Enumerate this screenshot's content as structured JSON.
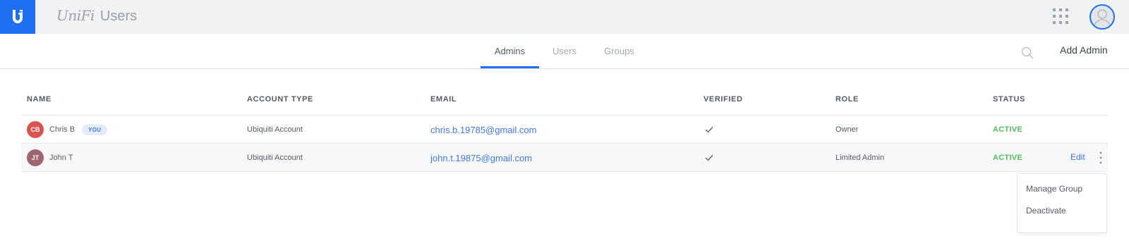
{
  "app": {
    "brand": "UniFi",
    "title": "Users"
  },
  "tabs": [
    {
      "label": "Admins",
      "active": true
    },
    {
      "label": "Users",
      "active": false
    },
    {
      "label": "Groups",
      "active": false
    }
  ],
  "actions": {
    "add_admin": "Add Admin"
  },
  "table": {
    "columns": [
      "NAME",
      "ACCOUNT TYPE",
      "EMAIL",
      "VERIFIED",
      "ROLE",
      "STATUS"
    ],
    "rows": [
      {
        "initials": "CB",
        "avatar_color": "#d9534f",
        "name": "Chris B",
        "badge": "YOU",
        "account_type": "Ubiquiti Account",
        "email": "chris.b.19785@gmail.com",
        "verified": true,
        "role": "Owner",
        "status": "ACTIVE"
      },
      {
        "initials": "JT",
        "avatar_color": "#a0666f",
        "name": "John T",
        "badge": "",
        "account_type": "Ubiquiti Account",
        "email": "john.t.19875@gmail.com",
        "verified": true,
        "role": "Limited Admin",
        "status": "ACTIVE",
        "edit_label": "Edit"
      }
    ]
  },
  "row_menu": {
    "items": [
      "Manage Group",
      "Deactivate"
    ]
  },
  "colors": {
    "accent": "#1f6ff2",
    "status_active": "#53c05a",
    "link": "#3f78e0"
  }
}
